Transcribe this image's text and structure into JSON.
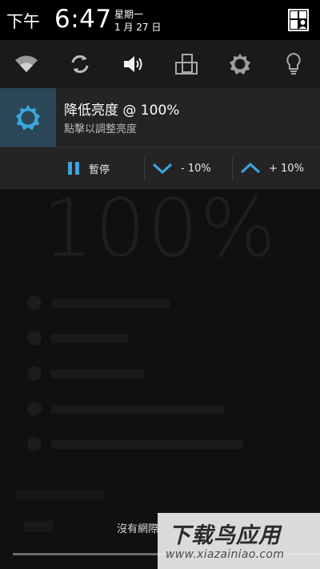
{
  "status_bar": {
    "am_pm": "下午",
    "time": "6:47",
    "weekday": "星期一",
    "date": "1 月 27 日",
    "user_icon": "user-switch-icon"
  },
  "quick_settings": [
    {
      "name": "wifi",
      "icon": "wifi-icon"
    },
    {
      "name": "sync",
      "icon": "sync-icon"
    },
    {
      "name": "sound",
      "icon": "volume-icon"
    },
    {
      "name": "rotation",
      "icon": "rotate-icon"
    },
    {
      "name": "brightness",
      "icon": "brightness-icon"
    },
    {
      "name": "flashlight",
      "icon": "bulb-icon"
    }
  ],
  "notification": {
    "icon": "brightness-icon",
    "title": "降低亮度 @ 100%",
    "subtitle": "點擊以調整亮度",
    "actions": [
      {
        "label": "暫停",
        "icon": "pause-icon"
      },
      {
        "label": "- 10%",
        "icon": "chevron-down-icon"
      },
      {
        "label": "+ 10%",
        "icon": "chevron-up-icon"
      }
    ],
    "accent_color": "#3aa5dc"
  },
  "background_app": {
    "big_value": "100%",
    "toast": "沒有網際"
  },
  "watermark": {
    "title": "下载鸟应用",
    "url": "www.xiazainiao.com"
  }
}
